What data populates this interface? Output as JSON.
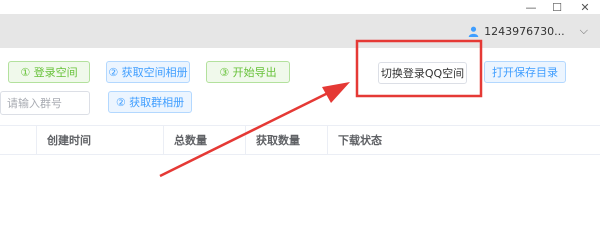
{
  "window": {
    "minimize_glyph": "—",
    "maximize_glyph": "☐",
    "close_glyph": "✕"
  },
  "user": {
    "name": "1243976730...",
    "dropdown_glyph": "⌵"
  },
  "toolbar": {
    "login_space": "① 登录空间",
    "get_space_album": "② 获取空间相册",
    "start_export": "③ 开始导出",
    "switch_login_space": "切换登录QQ空间",
    "open_save_dir": "打开保存目录",
    "get_group_album": "② 获取群相册"
  },
  "group_input": {
    "placeholder": "请输入群号",
    "value": ""
  },
  "table": {
    "columns": [
      "创建时间",
      "总数量",
      "获取数量",
      "下载状态"
    ]
  },
  "colors": {
    "highlight_box": "#e53935",
    "arrow": "#e53935",
    "green_button_text": "#67c23a",
    "blue_button_text": "#409eff"
  }
}
